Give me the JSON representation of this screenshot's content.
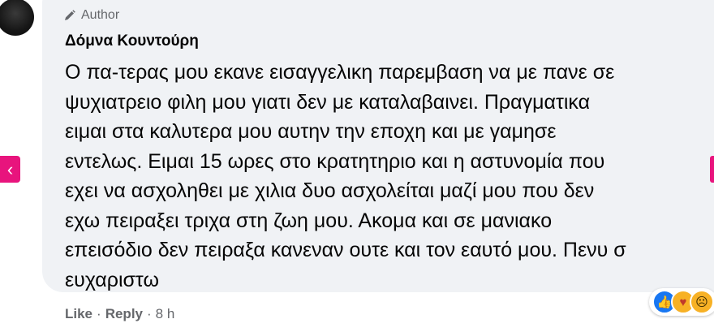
{
  "comment": {
    "badge_label": "Author",
    "badge_icon": "pencil-icon",
    "author_name": "Δόμνα Κουντούρη",
    "text_lines": [
      "Ο πα-τερας μου εκανε εισαγγελικη παρεμβαση να με πανε σε",
      "ψυχιατρειο φιλη μου γιατι δεν με καταλαβαινει. Πραγματικα",
      "ειμαι στα καλυτερα μου αυτην την εποχη και με γαμησε",
      "εντελως. Ειμαι 15 ωρες στο κρατητηριο και η αστυνομία που",
      "εχει να ασχοληθει με χιλια δυο ασχολείται μαζί μου που δεν",
      "εχω πειραξει τριχα στη ζωη μου. Ακομα και σε μανιακο",
      "επεισόδιο δεν πειραξα κανεναν ουτε και τον εαυτό μου. Πενυ σ",
      "ευχαριστω"
    ]
  },
  "actions": {
    "like_label": "Like",
    "separator": "·",
    "reply_label": "Reply",
    "time_label": "8 h"
  },
  "reactions": [
    {
      "icon": "thumbs-up-icon",
      "glyph": "👍",
      "color": "#1877f2"
    },
    {
      "icon": "care-icon",
      "glyph": "♥",
      "color": "#f7b125"
    },
    {
      "icon": "sad-icon",
      "glyph": "☹",
      "color": "#f7b125"
    }
  ],
  "nav": {
    "prev_glyph": "‹",
    "accent_color": "#e8147d"
  }
}
